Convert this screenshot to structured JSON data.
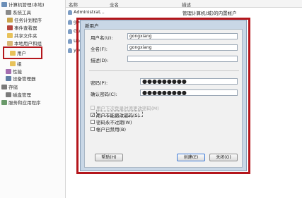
{
  "tree": {
    "root": "计算机管理(本地)",
    "system_tools": "系统工具",
    "task_scheduler": "任务计划程序",
    "event_viewer": "事件查看器",
    "shared_folders": "共享文件夹",
    "local_users": "本地用户和组",
    "users": "用户",
    "groups": "组",
    "performance": "性能",
    "device_manager": "设备管理器",
    "storage": "存储",
    "disk_management": "磁盘管理",
    "services": "服务和应用程序"
  },
  "list": {
    "headers": [
      "名称",
      "全名",
      "描述"
    ],
    "rows": [
      {
        "name": "Administrat...",
        "desc": "管理计算机(域)的内置帐户"
      },
      {
        "name": "gon",
        "desc": ""
      },
      {
        "name": "Gue",
        "desc": ""
      },
      {
        "name": "Upd",
        "desc": ""
      },
      {
        "name": "yue",
        "desc": ""
      }
    ]
  },
  "dialog": {
    "title": "新用户",
    "username_label": "用户名(U):",
    "username_value": "gongxiang",
    "fullname_label": "全名(F):",
    "fullname_value": "gongxiang",
    "desc_label": "描述(D):",
    "desc_value": "",
    "password_label": "密码(P):",
    "password_value": "●●●●●●●●●",
    "confirm_label": "确认密码(C):",
    "confirm_value": "●●●●●●●●●",
    "checkboxes": [
      {
        "label": "用户下次登录时须更改密码(M)",
        "checked": false,
        "disabled": true
      },
      {
        "label": "用户不能更改密码(S)",
        "checked": true,
        "disabled": false
      },
      {
        "label": "密码永不过期(W)",
        "checked": false,
        "disabled": false
      },
      {
        "label": "帐户已禁用(B)",
        "checked": false,
        "disabled": false
      }
    ],
    "check_mark": "✓",
    "help_button": "帮助(H)",
    "create_button": "创建(E)",
    "close_button": "关闭(O)"
  }
}
